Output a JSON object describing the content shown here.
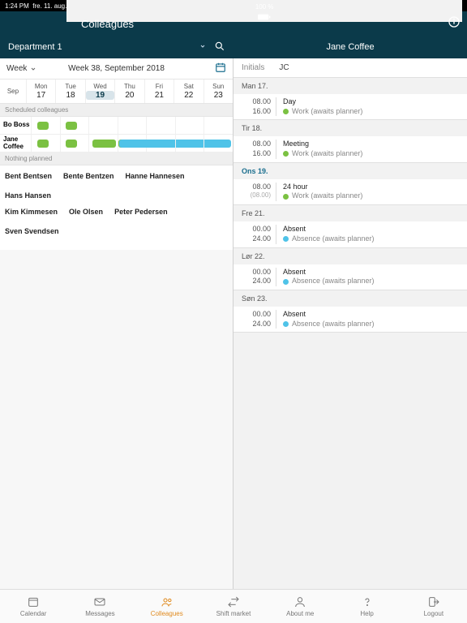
{
  "status": {
    "time": "1:24 PM",
    "date": "fre. 11. aug.",
    "battery": "100 %"
  },
  "header": {
    "title": "Colleagues",
    "department": "Department 1",
    "person": "Jane Coffee"
  },
  "weekbar": {
    "mode": "Week",
    "label": "Week 38, September 2018"
  },
  "days": {
    "first": "Sep",
    "cols": [
      {
        "wd": "Mon",
        "num": "17"
      },
      {
        "wd": "Tue",
        "num": "18"
      },
      {
        "wd": "Wed",
        "num": "19",
        "active": true
      },
      {
        "wd": "Thu",
        "num": "20"
      },
      {
        "wd": "Fri",
        "num": "21"
      },
      {
        "wd": "Sat",
        "num": "22"
      },
      {
        "wd": "Sun",
        "num": "23"
      }
    ]
  },
  "sections": {
    "scheduled": "Scheduled colleagues",
    "nothing": "Nothing planned"
  },
  "people": {
    "p0": "Bo Boss",
    "p1": "Jane Coffee"
  },
  "unscheduled": {
    "r0c0": "Bent Bentsen",
    "r0c1": "Bente Bentzen",
    "r0c2": "Hanne Hannesen",
    "r0c3": "Hans Hansen",
    "r1c0": "Kim Kimmesen",
    "r1c1": "Ole Olsen",
    "r1c2": "Peter Pedersen",
    "r1c3": "Sven Svendsen"
  },
  "detail": {
    "initials_lbl": "Initials",
    "initials": "JC",
    "d0": {
      "hdr": "Man 17.",
      "t1": "08.00",
      "t2": "16.00",
      "title": "Day",
      "sub": "Work (awaits planner)",
      "dot": "green"
    },
    "d1": {
      "hdr": "Tir 18.",
      "t1": "08.00",
      "t2": "16.00",
      "title": "Meeting",
      "sub": "Work (awaits planner)",
      "dot": "green"
    },
    "d2": {
      "hdr": "Ons 19.",
      "t1": "08.00",
      "t2": "(08.00)",
      "title": "24 hour",
      "sub": "Work (awaits planner)",
      "dot": "green",
      "active": true
    },
    "d3": {
      "hdr": "Fre 21.",
      "t1": "00.00",
      "t2": "24.00",
      "title": "Absent",
      "sub": "Absence (awaits planner)",
      "dot": "blue"
    },
    "d4": {
      "hdr": "Lør 22.",
      "t1": "00.00",
      "t2": "24.00",
      "title": "Absent",
      "sub": "Absence (awaits planner)",
      "dot": "blue"
    },
    "d5": {
      "hdr": "Søn 23.",
      "t1": "00.00",
      "t2": "24.00",
      "title": "Absent",
      "sub": "Absence (awaits planner)",
      "dot": "blue"
    }
  },
  "tabs": {
    "t0": "Calendar",
    "t1": "Messages",
    "t2": "Colleagues",
    "t3": "Shift market",
    "t4": "About me",
    "t5": "Help",
    "t6": "Logout"
  }
}
